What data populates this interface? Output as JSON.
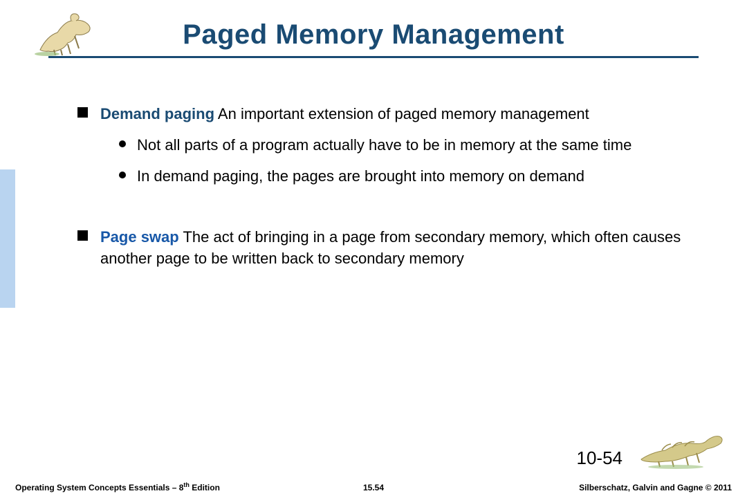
{
  "title": "Paged Memory Management",
  "bullets": [
    {
      "term": "Demand paging",
      "text": " An important extension of paged memory management",
      "sub": [
        "Not all parts of a program actually have to be in memory at the same time",
        "In demand paging, the pages are brought into memory on demand"
      ]
    },
    {
      "term": "Page swap",
      "text": "  The act of bringing in a page from secondary memory, which often causes another page to be written back to secondary memory"
    }
  ],
  "page_number_large": "10-54",
  "footer": {
    "left_prefix": "Operating System Concepts Essentials – 8",
    "left_super": "th",
    "left_suffix": " Edition",
    "center": "15.54",
    "right": "Silberschatz, Galvin and Gagne © 2011"
  }
}
